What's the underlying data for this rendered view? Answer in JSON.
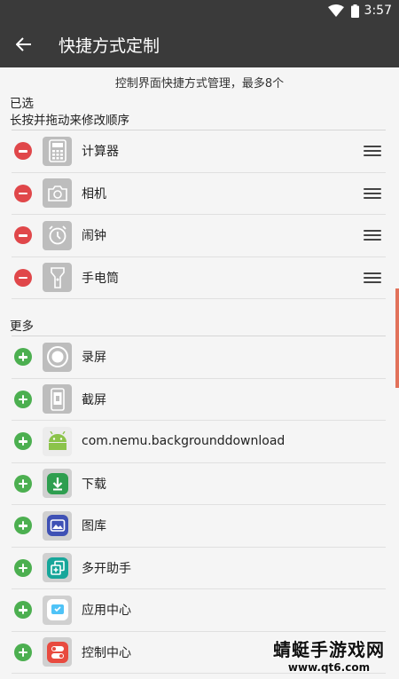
{
  "status_bar": {
    "time": "3:57"
  },
  "app_bar": {
    "title": "快捷方式定制"
  },
  "hint": "控制界面快捷方式管理，最多8个",
  "selected": {
    "title": "已选",
    "subtitle": "长按并拖动来修改顺序",
    "items": [
      {
        "label": "计算器",
        "icon": "calculator-icon"
      },
      {
        "label": "相机",
        "icon": "camera-icon"
      },
      {
        "label": "闹钟",
        "icon": "alarm-clock-icon"
      },
      {
        "label": "手电筒",
        "icon": "flashlight-icon"
      }
    ]
  },
  "more": {
    "title": "更多",
    "items": [
      {
        "label": "录屏",
        "icon": "screen-record-icon"
      },
      {
        "label": "截屏",
        "icon": "screenshot-icon"
      },
      {
        "label": "com.nemu.backgrounddownload",
        "icon": "android-icon"
      },
      {
        "label": "下载",
        "icon": "download-icon"
      },
      {
        "label": "图库",
        "icon": "gallery-icon"
      },
      {
        "label": "多开助手",
        "icon": "multi-open-icon"
      },
      {
        "label": "应用中心",
        "icon": "app-center-icon"
      },
      {
        "label": "控制中心",
        "icon": "control-center-icon"
      }
    ]
  },
  "watermark": {
    "title": "蜻蜓手游戏网",
    "url": "www.qt6.com"
  },
  "colors": {
    "app_bar": "#3a3a3a",
    "remove": "#e0474a",
    "add": "#4caf50",
    "scroll": "#e2725b"
  }
}
